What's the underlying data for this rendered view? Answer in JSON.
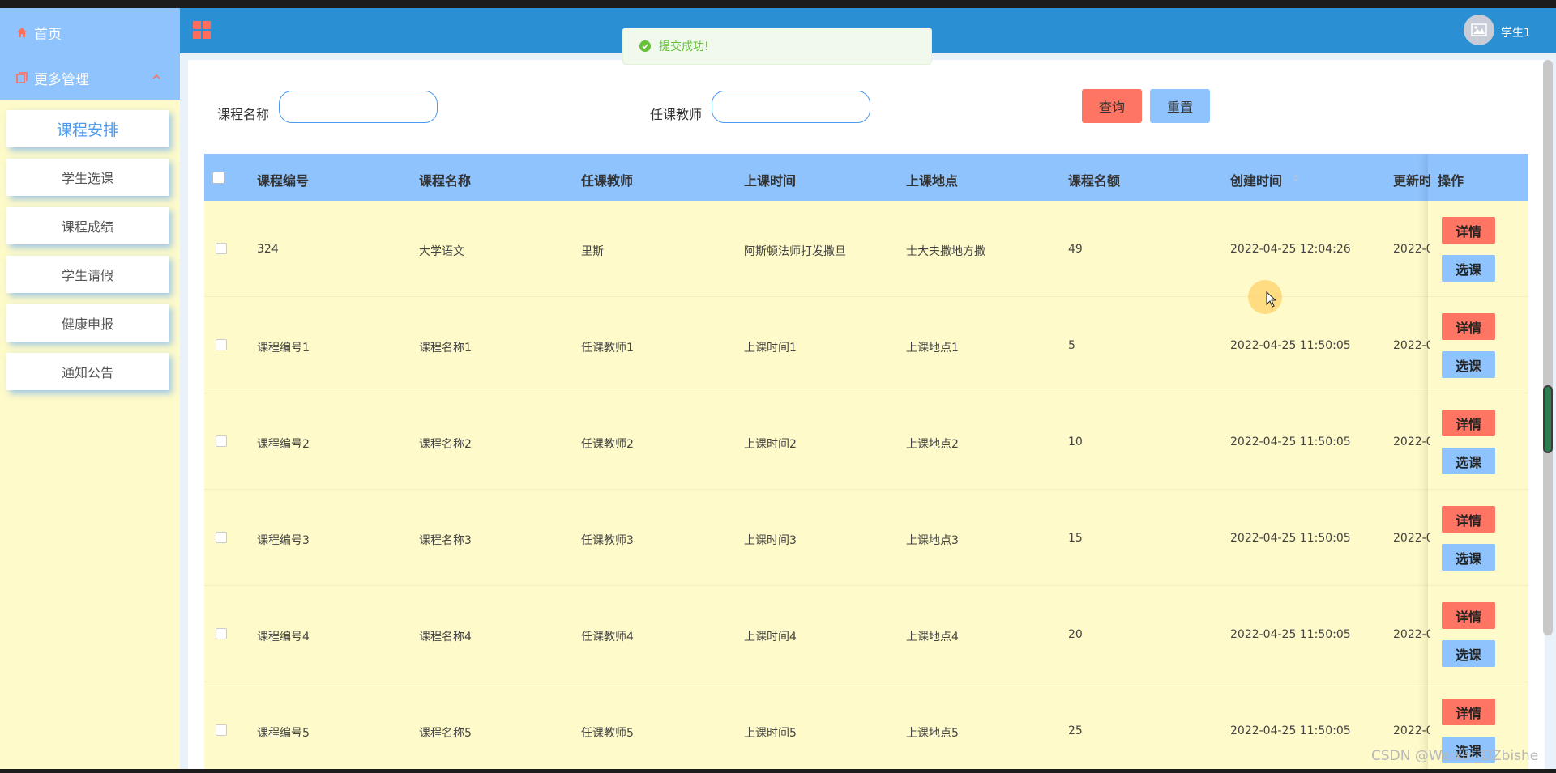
{
  "sidebar": {
    "home_label": "首页",
    "more_label": "更多管理",
    "items": [
      {
        "label": "课程安排",
        "active": true
      },
      {
        "label": "学生选课",
        "active": false
      },
      {
        "label": "课程成绩",
        "active": false
      },
      {
        "label": "学生请假",
        "active": false
      },
      {
        "label": "健康申报",
        "active": false
      },
      {
        "label": "通知公告",
        "active": false
      }
    ]
  },
  "header": {
    "username": "学生1"
  },
  "toast": {
    "message": "提交成功!"
  },
  "search": {
    "course_name_label": "课程名称",
    "course_name_value": "",
    "teacher_label": "任课教师",
    "teacher_value": "",
    "query_label": "查询",
    "reset_label": "重置"
  },
  "table": {
    "columns": [
      "课程编号",
      "课程名称",
      "任课教师",
      "上课时间",
      "上课地点",
      "课程名额",
      "创建时间",
      "更新时",
      "操作"
    ],
    "rows": [
      [
        "324",
        "大学语文",
        "里斯",
        "阿斯顿法师打发撒旦",
        "士大夫撒地方撒",
        "49",
        "2022-04-25 12:04:26",
        "2022-0"
      ],
      [
        "课程编号1",
        "课程名称1",
        "任课教师1",
        "上课时间1",
        "上课地点1",
        "5",
        "2022-04-25 11:50:05",
        "2022-0"
      ],
      [
        "课程编号2",
        "课程名称2",
        "任课教师2",
        "上课时间2",
        "上课地点2",
        "10",
        "2022-04-25 11:50:05",
        "2022-0"
      ],
      [
        "课程编号3",
        "课程名称3",
        "任课教师3",
        "上课时间3",
        "上课地点3",
        "15",
        "2022-04-25 11:50:05",
        "2022-0"
      ],
      [
        "课程编号4",
        "课程名称4",
        "任课教师4",
        "上课时间4",
        "上课地点4",
        "20",
        "2022-04-25 11:50:05",
        "2022-0"
      ],
      [
        "课程编号5",
        "课程名称5",
        "任课教师5",
        "上课时间5",
        "上课地点5",
        "25",
        "2022-04-25 11:50:05",
        "2022-0"
      ]
    ],
    "detail_label": "详情",
    "select_label": "选课"
  },
  "watermark": "CSDN @Weixin_DZbishe",
  "colors": {
    "header": "#2a8fd3",
    "sidebar_top": "#8ec3fd",
    "row_bg": "#fefac9",
    "danger": "#ff7563",
    "primary_light": "#8ec3fd",
    "success": "#67c23a"
  }
}
